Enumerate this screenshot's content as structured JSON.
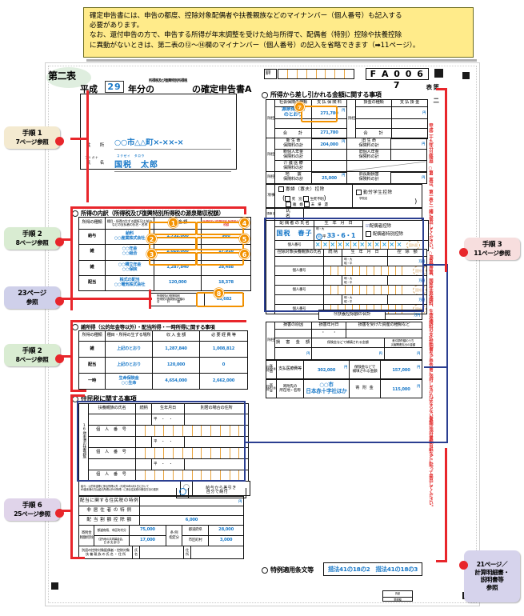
{
  "note": {
    "lines": [
      "確定申告書には、申告の都度、控除対象配偶者や扶養親族などのマイナンバー（個人番号）も記入する",
      "必要があります。",
      "なお、還付申告の方で、申告する所得が年末調整を受けた給与所得で、配偶者（特別）控除や扶養控除",
      "に異動がないときは、第二表の⑫～⑭欄のマイナンバー（個人番号）の記入を省略できます（➡11ページ）。"
    ]
  },
  "callouts": {
    "left": [
      {
        "title": "手順 1",
        "sub": "7ページ参照",
        "color": "#f4ead0"
      },
      {
        "title": "手順 2",
        "sub": "8ページ参照",
        "color": "#d9ecd2"
      },
      {
        "title": "23ページ",
        "sub": "参照",
        "color": "#cfd0ea"
      },
      {
        "title": "手順 2",
        "sub": "8ページ参照",
        "color": "#d9ecd2"
      },
      {
        "title": "手順 6",
        "sub": "25ページ参照",
        "color": "#e0d4ea"
      }
    ],
    "right": [
      {
        "title": "手順 3",
        "sub": "11ページ参照",
        "color": "#f7dede"
      },
      {
        "title": "21ページ／",
        "sub": "計算明細書・\n説明書等\n参照",
        "color": "#d6d3ec"
      }
    ]
  },
  "form": {
    "tab_label": "第二表",
    "era": "平成",
    "year": "29",
    "title_pre": "年分の",
    "title_ruby": "所得税及び復興特別所得税",
    "title_post": "の確定申告書A",
    "form_code": "F A 0 0 6 7",
    "address_label": "住　所",
    "address_value": "○○市△△町×-××-×",
    "name_label_ruby": "フリガナ",
    "name_label": "氏　名",
    "name_ruby": "コクゼイ　タロウ",
    "name_value": "国税　太郎"
  },
  "income_breakdown": {
    "title": "所得の内訳（所得税及び復興特別所得税の源泉徴収税額）",
    "headers": [
      "所得の種類",
      "種目・所得の生ずる場所又は\n給与などの支払者の氏名・名称",
      "収 入 金 額",
      "所得税及び復興特別\n所得税の源泉徴収税額"
    ],
    "rows": [
      {
        "kind": "給与",
        "source": "給料\n○○産業株式会社",
        "income": "1,752,000",
        "withheld": "900"
      },
      {
        "kind": "雑",
        "source": "○○年金\n○○組合",
        "income": "2,028,000",
        "withheld": "17,916"
      },
      {
        "kind": "雑",
        "source": "○○積立年金\n○○保険",
        "income": "1,287,840",
        "withheld": "28,488"
      },
      {
        "kind": "配当",
        "source": "株式の配当\n○○電気株式会社",
        "income": "120,000",
        "withheld": "18,378"
      }
    ],
    "total_label": "所得税及び復興特別\n所得税の源泉徴収税額の\n合　　　計　　　額",
    "total_mark": "㊽",
    "total_value": "65,682",
    "yen": "円",
    "bubbles": [
      "1",
      "2",
      "3",
      "4",
      "5",
      "6",
      "8"
    ]
  },
  "misc_income": {
    "title": "雑所得（公的年金等以外）・配当所得・一時所得に関する事項",
    "headers": [
      "所得の種類",
      "種目・所得の生ずる場所",
      "収 入 金 額",
      "必 要 経 費 等"
    ],
    "rows": [
      {
        "kind": "雑",
        "source": "上記のとおり",
        "income": "1,287,840",
        "expense": "1,008,812"
      },
      {
        "kind": "配当",
        "source": "上記のとおり",
        "income": "120,000",
        "expense": "0"
      },
      {
        "kind": "一時",
        "source": "生命保険金\n○○生命",
        "income": "4,654,000",
        "expense": "2,662,000"
      }
    ]
  },
  "resident_tax": {
    "title": "住民税に関する事項",
    "side_label": "16歳未満の扶養親族",
    "headers": [
      "扶養親族の氏名",
      "続柄",
      "生年月日",
      "別居の場合の住所"
    ],
    "mynumber_label": "個 人 番 号",
    "date_prefix": "平",
    "rows": 3,
    "collect_note": "給与・公的年金等に係る所得以外（平成30年4月1日において\n65歳未満の方は給与所得以外の所得）に係る住民税の徴収方法の選択",
    "collect_options": [
      "給与から差引き",
      "自分で納付"
    ],
    "collect_selected": "自分で納付",
    "fields": [
      {
        "label": "配当に関する住民税の特例",
        "value": "",
        "yen": "円"
      },
      {
        "label": "非 居 住 者 の 特 例",
        "value": ""
      },
      {
        "label": "配 当 割 額 控 除 額",
        "value": "6,000"
      }
    ],
    "donation": {
      "label": "寄附金\n税額控除",
      "rows": [
        {
          "label": "都道府県、市区町村分",
          "value": "75,000",
          "yen": "円"
        },
        {
          "label": "住所地の共同募金会、\n日 赤 支 部 分",
          "value": "17,000"
        }
      ],
      "right_label": "条 例\n指定分",
      "right_rows": [
        {
          "label": "都道府県",
          "value": "28,000",
          "yen": "円"
        },
        {
          "label": "市区町村",
          "value": "3,000"
        }
      ]
    },
    "separate_label": "別居の控除対象配偶者・控除対象\n扶 養 親 族 の 氏 名 ・ 住 所",
    "separate_name": "氏\n名",
    "separate_addr": "住\n所"
  },
  "deductions": {
    "title": "所得から差し引かれる金額に関する事項",
    "social": {
      "side": "⑥\n社\n会\n保\n険\n料\n控\n除",
      "headers": [
        "社会保険の種類",
        "支 払 保 険 料"
      ],
      "row1_kind": "源泉徴収票\nのとおり",
      "row1_value": "271,780",
      "total_label": "合　　計",
      "total_value": "271,780",
      "yen": "円"
    },
    "kyosai": {
      "side": "⑦\n小\n規\n模\n企\n業\n共\n済\n等\n掛\n金\n控\n除",
      "mark": "⑦",
      "headers": [
        "掛金の種類",
        "支 払 掛 金"
      ],
      "total_label": "合　　計",
      "yen": "円"
    },
    "life": {
      "side": "⑧\n生\n命\n保\n険\n料\n控\n除",
      "rows": [
        {
          "l": "新 生 命\n保険料の計",
          "v": "204,000",
          "r": "旧 生 命\n保険料の計",
          "rv": ""
        },
        {
          "l": "新個人年金\n保険料の計",
          "v": "",
          "r": "旧個人年金\n保険料の計",
          "rv": ""
        },
        {
          "l": "介 護 医 療\n保険料の計",
          "v": "",
          "r": "",
          "rv": ""
        }
      ],
      "yen": "円"
    },
    "earthquake": {
      "side": "⑨\n地\n震\n保\n険\n料\n控\n除",
      "l": "地　　震\n保険料の計",
      "v": "25,000",
      "r": "旧長期損害\n保険料の計",
      "rv": "",
      "yen": "円"
    },
    "widow": {
      "side": "⑩\n⑪\n本\n人\n に\n 関\n す\n る\n事\n項",
      "left_title": "寡婦（寡夫）控除",
      "left_opts": [
        "死　別",
        "生死不明",
        "離　婚",
        "未　帰　還"
      ],
      "right_title": "勤労学生控除",
      "right_sub": "学校名"
    },
    "spouse_hdr": "氏　　名",
    "spouse": {
      "side": "⑫\n⑬\n⑭\n配\n偶\n者\n や\n親\n族\n に\n関\n す\n る\n事\n項",
      "headers": [
        "配 偶 者 の 氏 名",
        "生　年　月　日"
      ],
      "name": "国税　春子",
      "era_opts": "明・大",
      "era_sel": "昭",
      "era2": "平",
      "birth": "33・6・1",
      "mynumber_label": "個人番号",
      "mynumber_marks": "×",
      "chk1": "配偶者控除",
      "chk1_checked": true,
      "chk2": "配偶者特別控除",
      "chk2_checked": false,
      "dep_headers": [
        "控除対象扶養親族の氏名",
        "続 柄",
        "生　年　月　日",
        "控　除　額"
      ],
      "dep_era": "明・大\n昭・平",
      "dep_unit": "万円",
      "dep_rows": 3,
      "total_label": "⑭扶養控除額の合計",
      "total_unit": "万円"
    },
    "casualty": {
      "side": "⑰\n雑\n損\n控\n除",
      "headers": [
        "損害の原因",
        "損害年月日",
        "損害を受けた資産の種類など"
      ],
      "headers2": [
        "損　害　金　額",
        "保険金などで補填される金額",
        "差引損失額のうち\n災害関連支出の金額"
      ],
      "yen": "円"
    },
    "medical": {
      "side": "⑱\n医療費\n控除",
      "label": "支払医療費等",
      "value": "302,000",
      "label2": "保険金などで\n補填される金額",
      "value2": "157,000",
      "yen": "円"
    },
    "donation": {
      "side": "⑲\n寄附金\n控除",
      "label": "寄附先の\n所在地・名称",
      "value": "○○市\n日本赤十字社ほか",
      "label2": "寄 附 金",
      "value2": "115,000",
      "yen": "円"
    },
    "special": {
      "title": "特例適用条文等",
      "value": "措法41の18の2　措法41の18の3"
    }
  },
  "side_vertical": {
    "title": "第 二 表",
    "text": "（平成二十九年分以降用）○第二表は、第一表と一緒に提出してください。○源泉徴収票、国民年金保険料、生命保険料の支払証明書など申告書に添付しなければならない書類は添付書類台紙などに貼って提出してください。"
  },
  "colors": {
    "orange": "#f39200",
    "red": "#e8262b",
    "blue": "#2b3f91",
    "value_blue": "#1878c8",
    "note_bg": "#ffeb8a"
  }
}
